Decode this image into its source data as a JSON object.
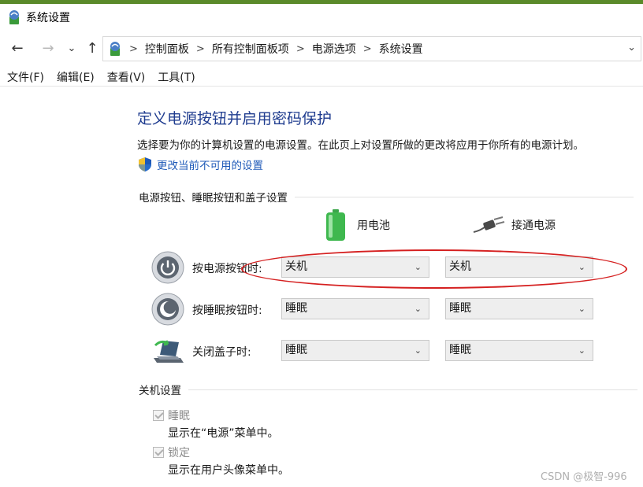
{
  "window": {
    "title": "系统设置"
  },
  "address_bar": {
    "breadcrumbs": [
      "控制面板",
      "所有控制面板项",
      "电源选项",
      "系统设置"
    ],
    "separator": ">"
  },
  "nav": {
    "back": "←",
    "forward": "→",
    "recent": "⌄",
    "up": "↑"
  },
  "menu": [
    "文件(F)",
    "编辑(E)",
    "查看(V)",
    "工具(T)"
  ],
  "page": {
    "heading": "定义电源按钮并启用密码保护",
    "description": "选择要为你的计算机设置的电源设置。在此页上对设置所做的更改将应用于你所有的电源计划。",
    "change_link": "更改当前不可用的设置"
  },
  "buttons_section": {
    "title": "电源按钮、睡眠按钮和盖子设置",
    "columns": {
      "battery": "用电池",
      "plugged": "接通电源"
    },
    "rows": [
      {
        "label": "按电源按钮时:",
        "battery": "关机",
        "plugged": "关机",
        "icon": "power-button-icon"
      },
      {
        "label": "按睡眠按钮时:",
        "battery": "睡眠",
        "plugged": "睡眠",
        "icon": "sleep-button-icon"
      },
      {
        "label": "关闭盖子时:",
        "battery": "睡眠",
        "plugged": "睡眠",
        "icon": "laptop-lid-icon"
      }
    ]
  },
  "shutdown_section": {
    "title": "关机设置",
    "items": [
      {
        "label": "睡眠",
        "sub": "显示在“电源”菜单中。",
        "checked": true
      },
      {
        "label": "锁定",
        "sub": "显示在用户头像菜单中。",
        "checked": true
      }
    ]
  },
  "watermark": "CSDN @极智-996",
  "colors": {
    "heading": "#1f3c8f",
    "link": "#1f5ab8",
    "highlight": "#d52020"
  }
}
